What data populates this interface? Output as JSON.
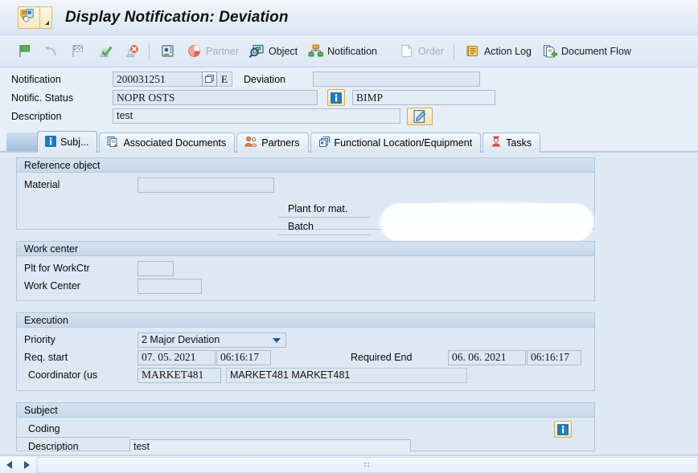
{
  "window": {
    "title": "Display Notification: Deviation",
    "title_icon": "notification-icon",
    "title_menu_icon": "menu-triangle-icon"
  },
  "toolbar": {
    "buttons": [
      {
        "name": "flag-green-button",
        "icon": "green-flag-icon",
        "label": "",
        "enabled": true,
        "type": "icon"
      },
      {
        "name": "undo-button",
        "icon": "undo-arrow-icon",
        "label": "",
        "enabled": false,
        "type": "icon"
      },
      {
        "name": "checkered-flag-button",
        "icon": "checkered-flag-icon",
        "label": "",
        "enabled": false,
        "type": "icon"
      },
      {
        "name": "complete-button",
        "icon": "stamp-check-icon",
        "label": "",
        "enabled": false,
        "type": "icon"
      },
      {
        "name": "reject-button",
        "icon": "stamp-cross-icon",
        "label": "",
        "enabled": false,
        "type": "icon"
      },
      {
        "name": "separator-1",
        "icon": "separator",
        "label": "",
        "enabled": false,
        "type": "sep"
      },
      {
        "name": "person-card-button",
        "icon": "person-card-icon",
        "label": "",
        "enabled": true,
        "type": "icon"
      },
      {
        "name": "partner-button",
        "icon": "partner-pie-icon",
        "label": "Partner",
        "enabled": false,
        "type": "text"
      },
      {
        "name": "object-button",
        "icon": "object-magnifier-icon",
        "label": "Object",
        "enabled": true,
        "type": "text"
      },
      {
        "name": "notification-button",
        "icon": "notification-tree-icon",
        "label": "Notification",
        "enabled": true,
        "type": "text"
      },
      {
        "name": "order-button",
        "icon": "order-page-icon",
        "label": "Order",
        "enabled": false,
        "type": "text"
      },
      {
        "name": "separator-2",
        "icon": "separator",
        "label": "",
        "enabled": false,
        "type": "sep"
      },
      {
        "name": "action-log-button",
        "icon": "action-log-scroll-icon",
        "label": "Action Log",
        "enabled": true,
        "type": "text"
      },
      {
        "name": "document-flow-button",
        "icon": "document-flow-icon",
        "label": "Document Flow",
        "enabled": true,
        "type": "text"
      }
    ]
  },
  "header": {
    "notification_label": "Notification",
    "notification_value": "200031251",
    "notification_matchcode_icon": "overlay-window-icon",
    "notification_lang": "E",
    "notification_type_text": "Deviation",
    "notification_type_value": "",
    "status_label": "Notific. Status",
    "status_value": "NOPR OSTS",
    "status_info_icon": "info-icon",
    "status_system": "BIMP",
    "description_label": "Description",
    "description_value": "test",
    "description_extra_value": "",
    "description_edit_icon": "pencil-edit-icon"
  },
  "tabs": [
    {
      "name": "tab-subject",
      "label": "Subj...",
      "icon": "info-blue-icon",
      "active": true
    },
    {
      "name": "tab-associated-documents",
      "label": "Associated Documents",
      "icon": "documents-icon",
      "active": false
    },
    {
      "name": "tab-partners",
      "label": "Partners",
      "icon": "partners-people-icon",
      "active": false
    },
    {
      "name": "tab-functional-location",
      "label": "Functional Location/Equipment",
      "icon": "equipment-cube-icon",
      "active": false
    },
    {
      "name": "tab-tasks",
      "label": "Tasks",
      "icon": "tasks-person-icon",
      "active": false
    }
  ],
  "groups": {
    "reference_object": {
      "title": "Reference object",
      "material_label": "Material",
      "material_value": "",
      "plant_label": "Plant for mat.",
      "plant_value": "",
      "batch_label": "Batch",
      "batch_value": "",
      "redaction": "white-brush-redaction"
    },
    "work_center": {
      "title": "Work center",
      "plant_label": "Plt for WorkCtr",
      "plant_value": "",
      "workcenter_label": "Work Center",
      "workcenter_value": ""
    },
    "execution": {
      "title": "Execution",
      "priority_label": "Priority",
      "priority_value": "2 Major Deviation",
      "priority_options": [
        "2 Major Deviation"
      ],
      "req_start_label": "Req. start",
      "req_start_date": "07. 05. 2021",
      "req_start_time": "06:16:17",
      "required_end_label": "Required End",
      "required_end_date": "06. 06. 2021",
      "required_end_time": "06:16:17",
      "coordinator_label": "Coordinator (us",
      "coordinator_value": "MARKET481",
      "coordinator_name": "MARKET481 MARKET481"
    },
    "subject": {
      "title": "Subject",
      "coding_label": "Coding",
      "coding_value": "",
      "coding_info_icon": "info-icon",
      "description_label": "Description",
      "description_value": "test"
    }
  },
  "scrollbar": {
    "left_icon": "scroll-left-arrow-icon",
    "right_icon": "scroll-right-arrow-icon",
    "grip_icon": "scroll-grip-icon"
  },
  "colors": {
    "accent_blue": "#1b5d96",
    "panel_bg": "#dfe9f4",
    "field_bg": "#dce7f2",
    "field_border": "#a9bccd",
    "group_border": "#b3c7da"
  }
}
